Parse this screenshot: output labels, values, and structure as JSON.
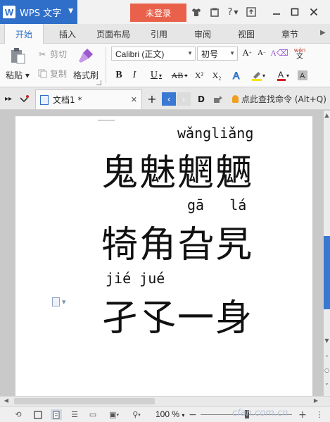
{
  "titlebar": {
    "app_logo": "W",
    "app_name": "WPS 文字",
    "login_label": "未登录",
    "icons": [
      "shirt-icon",
      "skin-icon",
      "help-icon",
      "share-icon",
      "minimize-icon",
      "maximize-icon",
      "close-icon"
    ]
  },
  "tabs": [
    {
      "label": "开始",
      "active": true
    },
    {
      "label": "插入"
    },
    {
      "label": "页面布局"
    },
    {
      "label": "引用"
    },
    {
      "label": "审阅"
    },
    {
      "label": "视图"
    },
    {
      "label": "章节"
    }
  ],
  "ribbon": {
    "paste_label": "粘贴",
    "cut_label": "剪切",
    "copy_label": "复制",
    "format_painter_label": "格式刷",
    "font_name": "Calibri (正文)",
    "font_size": "初号",
    "bold": "B",
    "italic": "I",
    "underline": "U",
    "strike": "AB",
    "superscript": "X²",
    "subscript": "X₂",
    "phonetic_guide": "wén",
    "phonetic_sub": "文",
    "accent_color": "#2f6fc9"
  },
  "docbar": {
    "doc_title": "文档1 *",
    "search_command": "点此查找命令 (Alt+Q)"
  },
  "document": {
    "lines": [
      {
        "pinyin": "wǎngliǎng",
        "text": "鬼魅魍魉"
      },
      {
        "pinyin": "gā   lá",
        "text": "犄角旮旯"
      },
      {
        "pinyin": "jié jué",
        "text": "孑孓一身"
      }
    ]
  },
  "statusbar": {
    "zoom": "100 %",
    "watermark": "cfan.com.cn"
  }
}
